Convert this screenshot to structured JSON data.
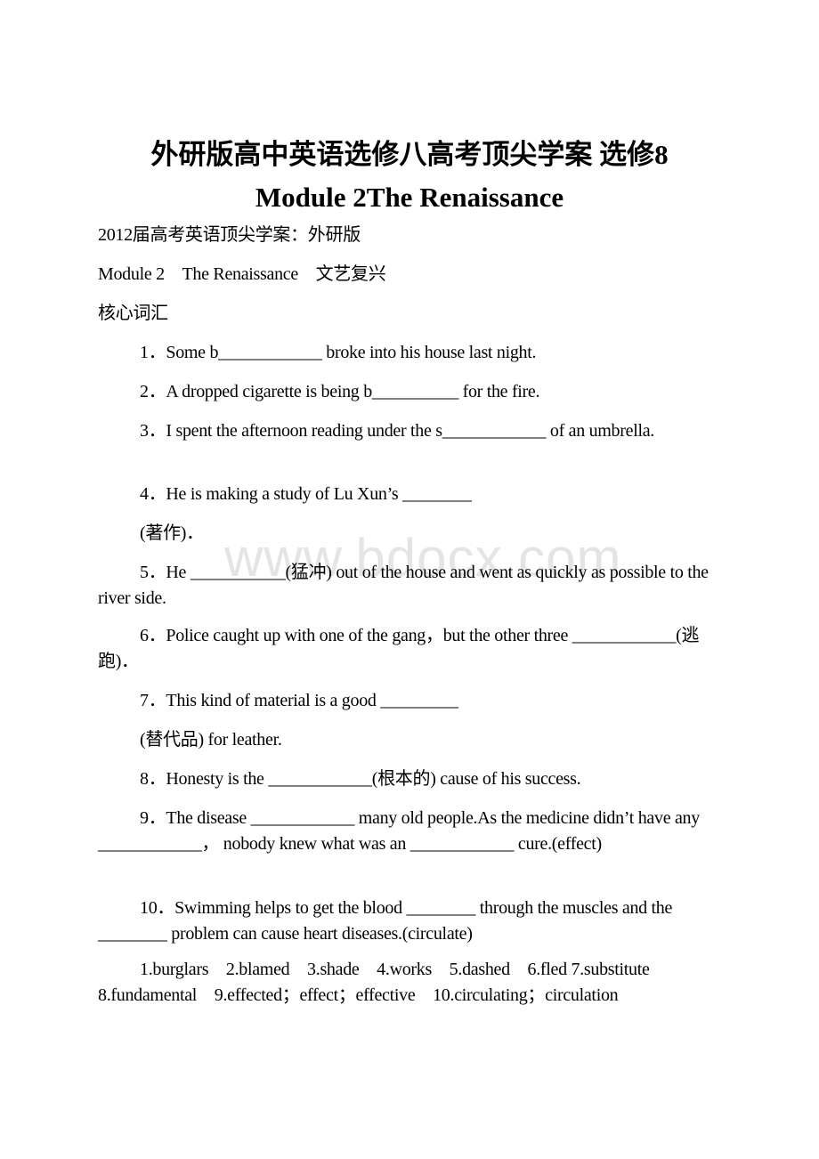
{
  "document": {
    "title_line1": "外研版高中英语选修八高考顶尖学案 选修8",
    "title_line2": "Module 2The Renaissance",
    "subtitle": "2012届高考英语顶尖学案：外研版",
    "module_line": "Module 2　The Renaissance　文艺复兴",
    "section_heading": "核心词汇",
    "watermark": "www.bdocx.com",
    "questions": [
      "1．Some b____________ broke into his house last night.",
      "2．A dropped cigarette is being b__________ for the fire.",
      "3．I spent the afternoon reading under the s____________ of an umbrella.",
      "4．He is making a study of Lu Xun’s ________",
      "(著作)．",
      "5．He ___________(猛冲) out of the house and went as quickly as possible to the river side.",
      "6．Police caught up with one of the gang，but the other three ____________(逃跑)．",
      "7．This kind of material is a good _________",
      "(替代品) for leather.",
      "8．Honesty is the ____________(根本的) cause of his success.",
      "9．The disease ____________ many old people.As the medicine didn’t have any ____________， nobody knew what was an ____________ cure.(effect)",
      "10．Swimming helps to get the blood ________ through the muscles and the ________ problem can cause heart diseases.(circulate)"
    ],
    "answers": "1.burglars　2.blamed　3.shade　4.works　5.dashed　6.fled 7.substitute 8.fundamental　9.effected；effect；effective　10.circulating；circulation"
  }
}
